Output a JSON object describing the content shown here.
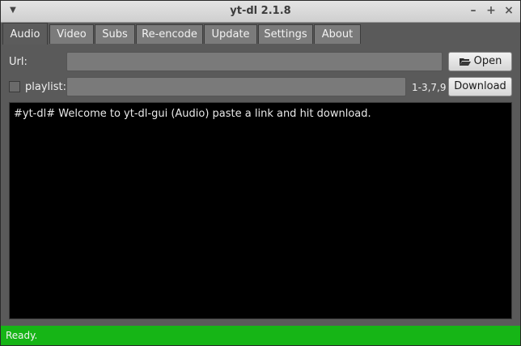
{
  "window": {
    "title": "yt-dl 2.1.8",
    "menu_icon": "chevron-down-icon",
    "minimize_icon": "minimize-icon",
    "maximize_icon": "maximize-icon",
    "close_icon": "close-icon"
  },
  "tabs": [
    {
      "label": "Audio",
      "active": true
    },
    {
      "label": "Video"
    },
    {
      "label": "Subs"
    },
    {
      "label": "Re-encode"
    },
    {
      "label": "Update"
    },
    {
      "label": "Settings"
    },
    {
      "label": "About"
    }
  ],
  "url_row": {
    "label": "Url:",
    "value": "",
    "open_button": "Open",
    "open_icon": "folder-open-icon"
  },
  "playlist_row": {
    "checked": false,
    "label": "playlist:",
    "value": "",
    "hint": "1-3,7,9",
    "download_button": "Download"
  },
  "console": {
    "text": "#yt-dl# Welcome to yt-dl-gui (Audio) paste a link and hit download."
  },
  "status": {
    "text": "Ready.",
    "color": "#16b516"
  }
}
